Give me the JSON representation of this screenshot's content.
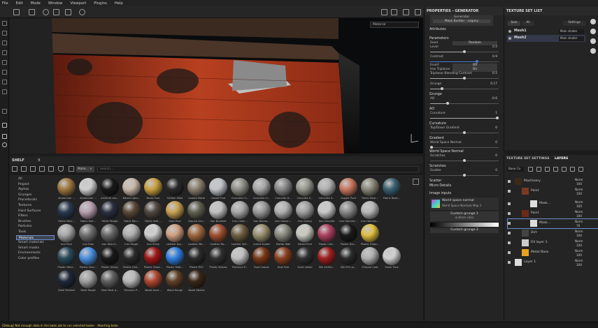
{
  "menu": [
    "File",
    "Edit",
    "Mode",
    "Window",
    "Viewport",
    "Plugins",
    "Help"
  ],
  "viewport": {
    "material_select": "Material"
  },
  "shelf": {
    "tabs": [
      "SHELF",
      "9"
    ],
    "search_placeholder": "Search...",
    "filter_chip": "Mater...",
    "categories": [
      "All",
      "Project",
      "Alphas",
      "Grunges",
      "Procedurals",
      "Textures",
      "Hard Surfaces",
      "Filters",
      "Brushes",
      "Particles",
      "Tools",
      "Materials",
      "Smart materials",
      "Smart masks",
      "Environments",
      "Color profiles"
    ],
    "selected_category": "Materials",
    "rows": [
      [
        [
          "Aluminium ...",
          "#a07840"
        ],
        [
          "Aluminium ...",
          "#d0d0d0"
        ],
        [
          "Artificial Lea...",
          "#1a1a1a"
        ],
        [
          "Baked Light...",
          "#c8b8a8"
        ],
        [
          "Brass Pure",
          "#c8a040"
        ],
        [
          "Carbon Fiber",
          "#2a2a2a"
        ],
        [
          "Coated Metal",
          "#8a8070"
        ],
        [
          "Cobalt Pure",
          "#c0c4c8"
        ],
        [
          "Concrete Cl...",
          "#909088"
        ],
        [
          "Concrete Cl...",
          "#a8a8a8"
        ],
        [
          "Concrete D...",
          "#888"
        ],
        [
          "Concrete S...",
          "#989890"
        ],
        [
          "Concrete S...",
          "#b0b0b0"
        ],
        [
          "Copper Pure",
          "#c87860"
        ],
        [
          "Fabric Bam...",
          "#8a8878"
        ],
        [
          "Fabric Base...",
          "#3a6070"
        ]
      ],
      [
        [
          "Fabric Deni...",
          "#2a3a50"
        ],
        [
          "Fabric Knit...",
          "#b8a0b0"
        ],
        [
          "Fabric Rough",
          "#2a3040"
        ],
        [
          "Fabric Rou...",
          "#5a4838"
        ],
        [
          "Fabric Soft ...",
          "#504840"
        ],
        [
          "Gold Pure",
          "#c8a050"
        ],
        [
          "Ground Gra...",
          "#606050"
        ],
        [
          "Iron Brushed",
          "#c0c0c0"
        ],
        [
          "Iron Chain...",
          "#a8a8a8"
        ],
        [
          "Iron Diamo...",
          "#9a9a9a"
        ],
        [
          "Iron Galvan...",
          "#b0b0b0"
        ],
        [
          "Iron Grainy",
          "#a0a0a0"
        ],
        [
          "Iron Grinded",
          "#c8c8c8"
        ],
        [
          "Iron Hamme...",
          "#888"
        ],
        [
          "Iron Hamme...",
          "#b8b8b8"
        ]
      ],
      [
        [
          "Iron Pure",
          "#a8a8a8"
        ],
        [
          "Iron Raw",
          "#707070"
        ],
        [
          "Iron Raw D...",
          "#686868"
        ],
        [
          "Iron Rough",
          "#b0b0b0"
        ],
        [
          "Iron Shiny",
          "#d0d0d0"
        ],
        [
          "Leather biq...",
          "#d0a080"
        ],
        [
          "Leather Me...",
          "#a06840"
        ],
        [
          "Leather Ro...",
          "#a05030"
        ],
        [
          "Leather Sof...",
          "#706040"
        ],
        [
          "Lizard Scales",
          "#9a9070"
        ],
        [
          "Mortar Wall",
          "#8a8a80"
        ],
        [
          "Nickel Pure",
          "#c8c8c0"
        ],
        [
          "Plastic Cell...",
          "#b04060"
        ],
        [
          "Plastic Dia...",
          "#1a1a1a"
        ],
        [
          "Plastic Gloss...",
          "#e0c040"
        ]
      ],
      [
        [
          "Plastic Fabri...",
          "#2a4a5a"
        ],
        [
          "Plastic Glos...",
          "#4a90e0"
        ],
        [
          "Plastic Glossy",
          "#1a1a1a"
        ],
        [
          "Plastic Grid...",
          "#2a2a2a"
        ],
        [
          "Plastic Gloss...",
          "#a01818"
        ],
        [
          "Plastic Matt...",
          "#3080e0"
        ],
        [
          "Plastic PVC",
          "#2a2a2a"
        ],
        [
          "Plastic Stripes",
          "#303030"
        ],
        [
          "Platinum P...",
          "#c0c0c0"
        ],
        [
          "Rust Coarse",
          "#7a3818"
        ],
        [
          "Rust Fine",
          "#8a4020"
        ],
        [
          "Scarf wheel",
          "#303030"
        ],
        [
          "Silk Artifici...",
          "#a02020"
        ],
        [
          "Silk PVC pl...",
          "#2a2a2a"
        ],
        [
          "Silicone Coat",
          "#b0b0b0"
        ],
        [
          "Silver Pure",
          "#d0d0d0"
        ]
      ],
      [
        [
          "Steel Painted",
          "#202838"
        ],
        [
          "Steel Rough",
          "#a0a0a0"
        ],
        [
          "Steel Rust a...",
          "#606060"
        ],
        [
          "Titanium P...",
          "#b8b8b8"
        ],
        [
          "Wood Amer...",
          "#b04830"
        ],
        [
          "Wood Rough",
          "#604028"
        ],
        [
          "Wood Walnut",
          "#3a2818"
        ]
      ]
    ]
  },
  "properties": {
    "title": "PROPERTIES - GENERATOR",
    "generator_name": "Generator",
    "generator_sub": "Mask Builder - Legacy",
    "sections": {
      "attributes": "Attributes",
      "parameters": "Parameters",
      "grunge": "Grunge",
      "ao": "AO",
      "curvature": "Curvature",
      "gradient": "Gradient",
      "wsn": "World Space Normal",
      "scratches": "Scratches",
      "scatter": "Scatter",
      "micro": "Micro Details",
      "image_inputs": "Image inputs"
    },
    "seed_label": "Seed",
    "seed_value": "Random",
    "level_label": "Level",
    "level_value": "0.5",
    "contrast_label": "Contrast",
    "contrast_value": "0.9",
    "invert_label": "Invert",
    "invert_value": "Off",
    "triplanar_label": "Use Triplanar",
    "triplanar_value": "On",
    "tri_blend_label": "Triplanar Blending Contrast",
    "tri_blend_value": "0.5",
    "grunge_label": "Grunge",
    "grunge_value": "0.17",
    "ao_label": "AO",
    "ao_value": "-0.6",
    "curv_label": "Curvature",
    "curv_value": "1",
    "topbot_label": "Top/Down Gradient",
    "topbot_value": "0",
    "wsn_label": "World Space Normal",
    "wsn_value": "0",
    "scr_label": "Scratches",
    "scr_value": "0",
    "scatter_label": "Scatter",
    "scatter_value": "0",
    "img1_title": "World space normal",
    "img1_sub": "World Space Normals Map 1",
    "custom1_title": "Custom grunge 1",
    "custom1_sub": "uniform color",
    "custom2_title": "Custom grunge 2"
  },
  "texture_sets": {
    "title": "TEXTURE SET LIST",
    "tabs": [
      "Solo",
      "All"
    ],
    "settings_btn": "Settings",
    "items": [
      {
        "name": "Mesh1",
        "shader": "Main shader"
      },
      {
        "name": "Mesh2",
        "shader": "Main shader"
      }
    ]
  },
  "layers_panel": {
    "tabs": [
      "TEXTURE SET SETTINGS",
      "LAYERS"
    ],
    "base_channel": "Base Co",
    "layers": [
      {
        "name": "Machinery",
        "blend": "Norm",
        "opacity": "100"
      },
      {
        "name": "Paint",
        "blend": "Norm",
        "opacity": "100"
      },
      {
        "name": "Mask...",
        "blend": "Norm",
        "opacity": "100"
      },
      {
        "name": "Paint",
        "blend": "Norm",
        "opacity": "100"
      },
      {
        "name": "Mask...",
        "blend": "Norm",
        "opacity": "70"
      },
      {
        "name": "Dirt",
        "blend": "Norm",
        "opacity": "100"
      },
      {
        "name": "Fill layer 1",
        "blend": "Norm",
        "opacity": "100"
      },
      {
        "name": "Metal Base",
        "blend": "Norm",
        "opacity": "100"
      },
      {
        "name": "Layer 1",
        "blend": "Norm",
        "opacity": "100"
      }
    ]
  },
  "status": "[Debug] Not enough data in the bake job to run selected baker - Aborting bake."
}
